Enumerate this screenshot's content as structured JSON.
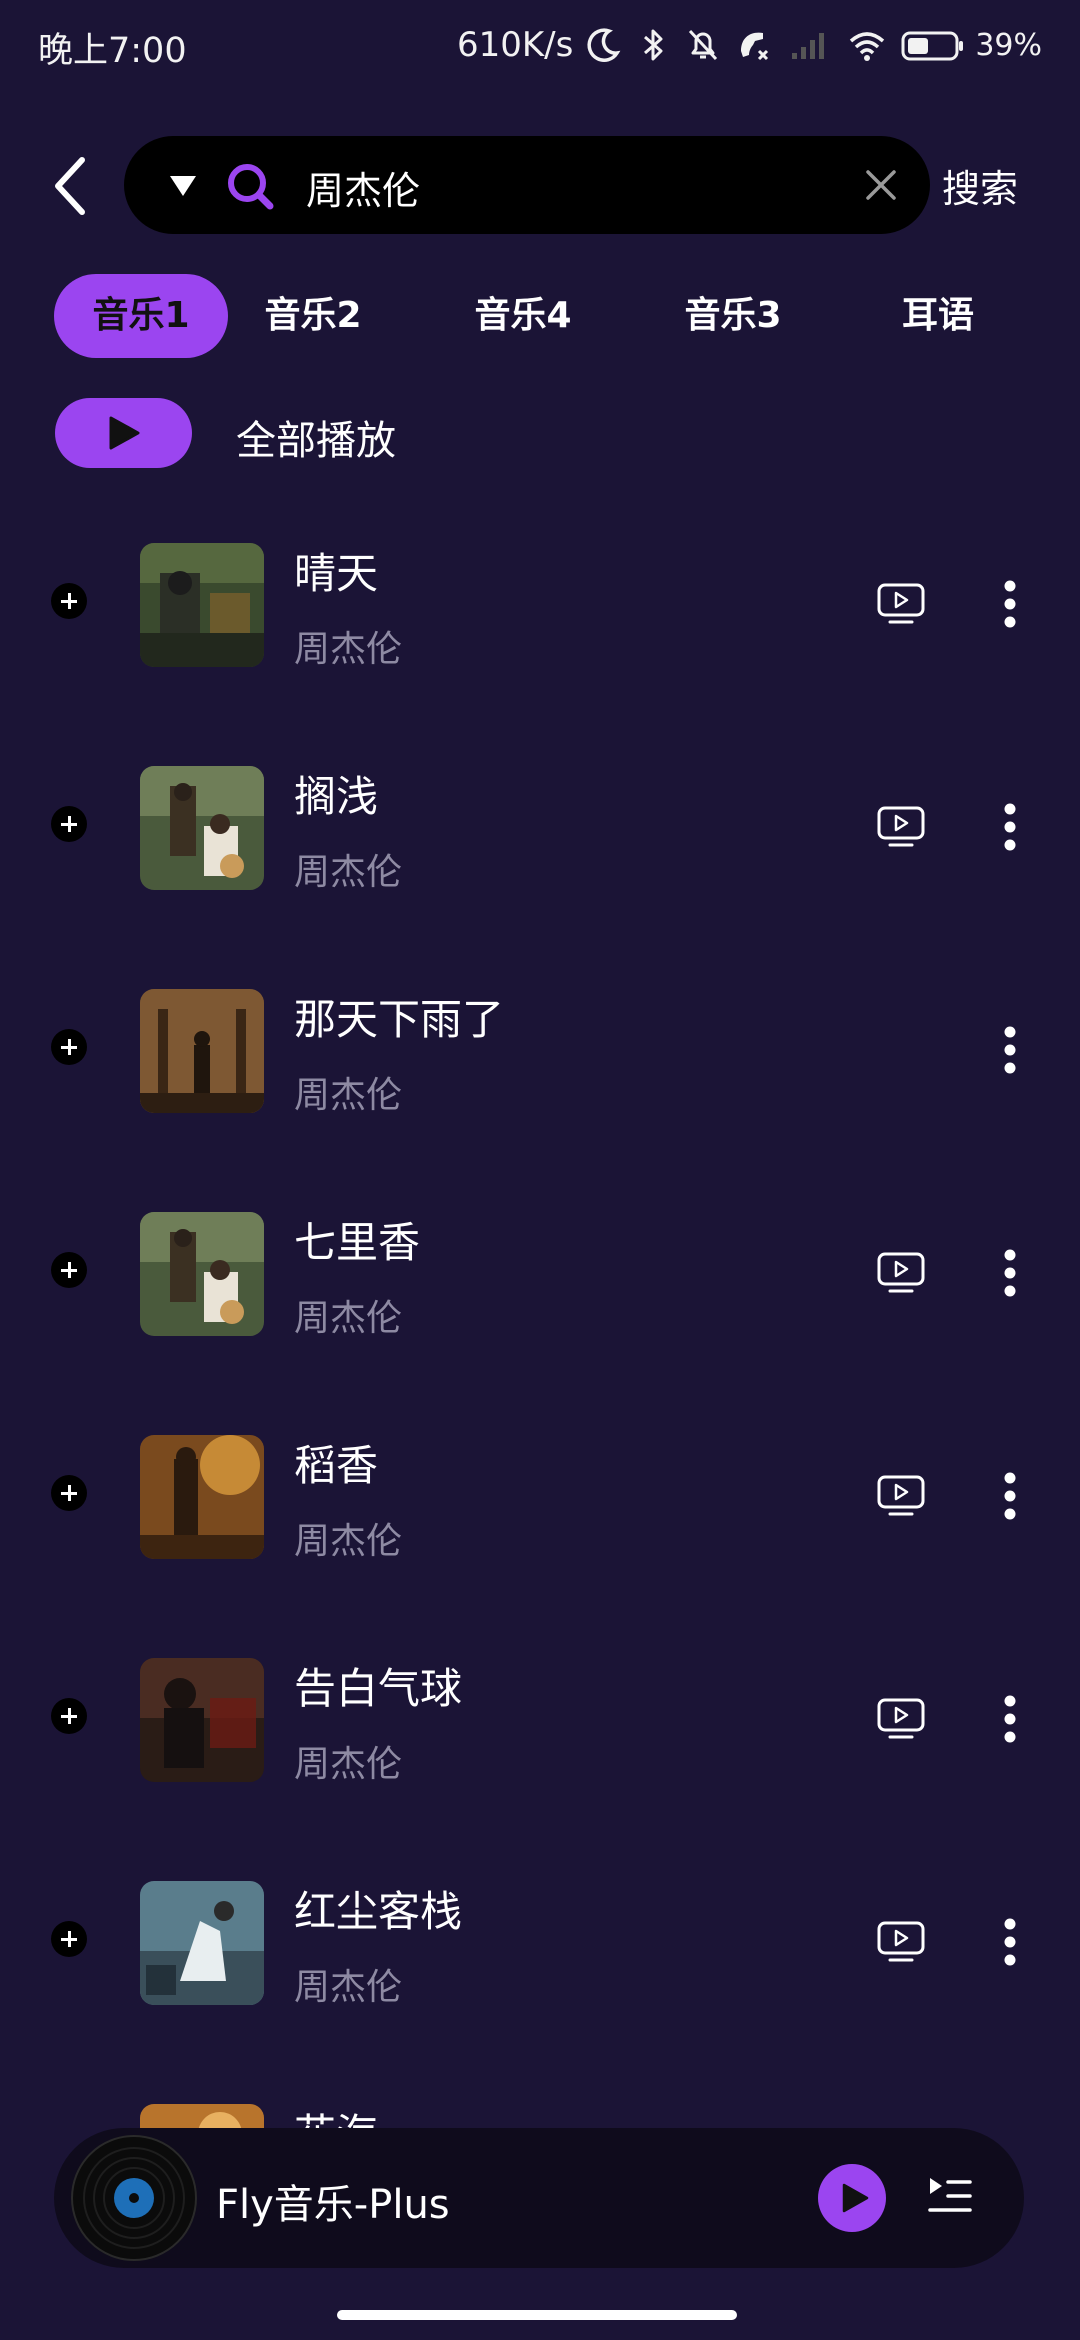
{
  "status_bar": {
    "time": "晚上7:00",
    "net_speed": "610K/s",
    "battery_pct": "39%",
    "icons": [
      "moon-icon",
      "bluetooth-icon",
      "mute-bell-icon",
      "call-off-icon",
      "signal-icon",
      "wifi-icon",
      "battery-icon"
    ]
  },
  "search": {
    "query": "周杰伦",
    "button_label": "搜索"
  },
  "tabs": [
    {
      "label": "音乐1",
      "active": true
    },
    {
      "label": "音乐2",
      "active": false
    },
    {
      "label": "音乐4",
      "active": false
    },
    {
      "label": "音乐3",
      "active": false
    },
    {
      "label": "耳语",
      "active": false
    }
  ],
  "play_all_label": "全部播放",
  "songs": [
    {
      "title": "晴天",
      "artist": "周杰伦",
      "has_mv": true
    },
    {
      "title": "搁浅",
      "artist": "周杰伦",
      "has_mv": true
    },
    {
      "title": "那天下雨了",
      "artist": "周杰伦",
      "has_mv": false
    },
    {
      "title": "七里香",
      "artist": "周杰伦",
      "has_mv": true
    },
    {
      "title": "稻香",
      "artist": "周杰伦",
      "has_mv": true
    },
    {
      "title": "告白气球",
      "artist": "周杰伦",
      "has_mv": true
    },
    {
      "title": "红尘客栈",
      "artist": "周杰伦",
      "has_mv": true
    },
    {
      "title": "花海",
      "artist": "",
      "has_mv": false
    }
  ],
  "player": {
    "title": "Fly音乐-Plus"
  },
  "colors": {
    "background": "#1b1436",
    "accent": "#9b45f0",
    "search_bg": "#000000",
    "secondary_text": "#8e8aa3"
  }
}
